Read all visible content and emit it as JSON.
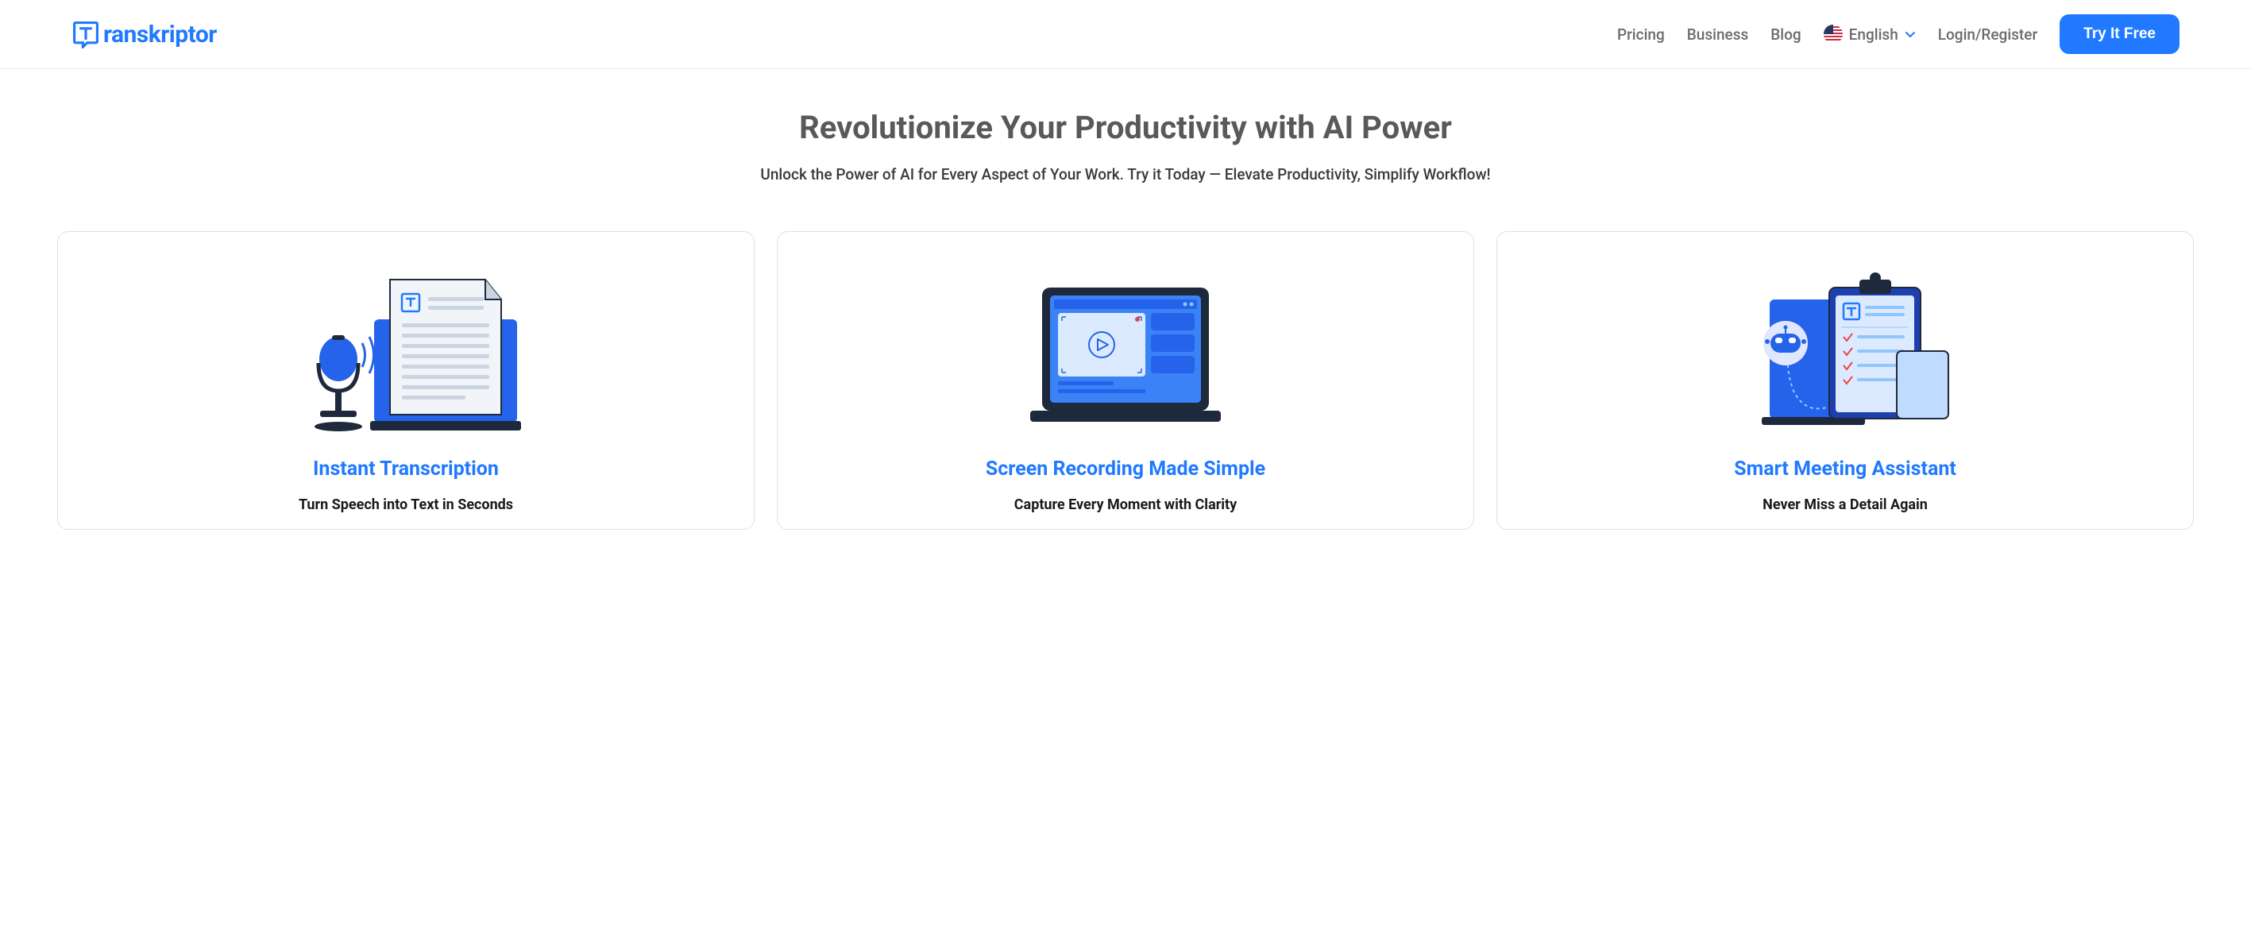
{
  "header": {
    "logo_text": "ranskriptor",
    "nav": {
      "pricing": "Pricing",
      "business": "Business",
      "blog": "Blog",
      "language": "English",
      "login": "Login/Register"
    },
    "cta": "Try It Free"
  },
  "hero": {
    "title": "Revolutionize Your Productivity with AI Power",
    "subtitle": "Unlock the Power of AI for Every Aspect of Your Work. Try it Today — Elevate Productivity, Simplify Workflow!"
  },
  "cards": [
    {
      "title": "Instant Transcription",
      "subtitle": "Turn Speech into Text in Seconds"
    },
    {
      "title": "Screen Recording Made Simple",
      "subtitle": "Capture Every Moment with Clarity"
    },
    {
      "title": "Smart Meeting Assistant",
      "subtitle": "Never Miss a Detail Again"
    }
  ],
  "colors": {
    "primary": "#2079ff",
    "heading": "#595959",
    "text": "#3a3a3a",
    "nav": "#6b6b6b"
  }
}
